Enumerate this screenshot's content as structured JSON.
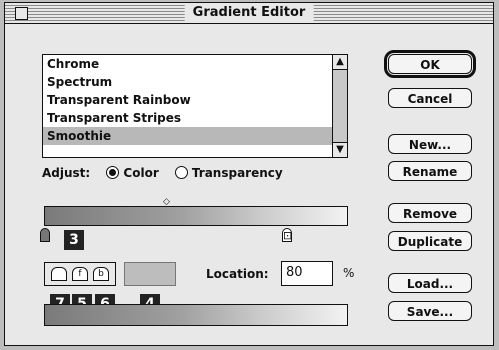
{
  "window": {
    "title": "Gradient Editor"
  },
  "gradient_list": {
    "items": [
      "Chrome",
      "Spectrum",
      "Transparent Rainbow",
      "Transparent Stripes",
      "Smoothie"
    ],
    "selected_index": 4
  },
  "adjust": {
    "label": "Adjust:",
    "options": [
      "Color",
      "Transparency"
    ],
    "selected": "Color"
  },
  "callouts": {
    "three": "3",
    "four": "4",
    "five": "5",
    "six": "6",
    "seven": "7"
  },
  "location": {
    "label": "Location:",
    "value": "80",
    "unit": "%"
  },
  "buttons": {
    "ok": "OK",
    "cancel": "Cancel",
    "new": "New...",
    "rename": "Rename",
    "remove": "Remove",
    "duplicate": "Duplicate",
    "load": "Load...",
    "save": "Save..."
  },
  "icons": {
    "close": "close-box-icon",
    "scroll_up": "scroll-up-arrow-icon",
    "scroll_down": "scroll-down-arrow-icon",
    "midpoint": "diamond-midpoint-icon",
    "stop_left": "color-stop-icon",
    "stop_right": "color-stop-icon"
  }
}
